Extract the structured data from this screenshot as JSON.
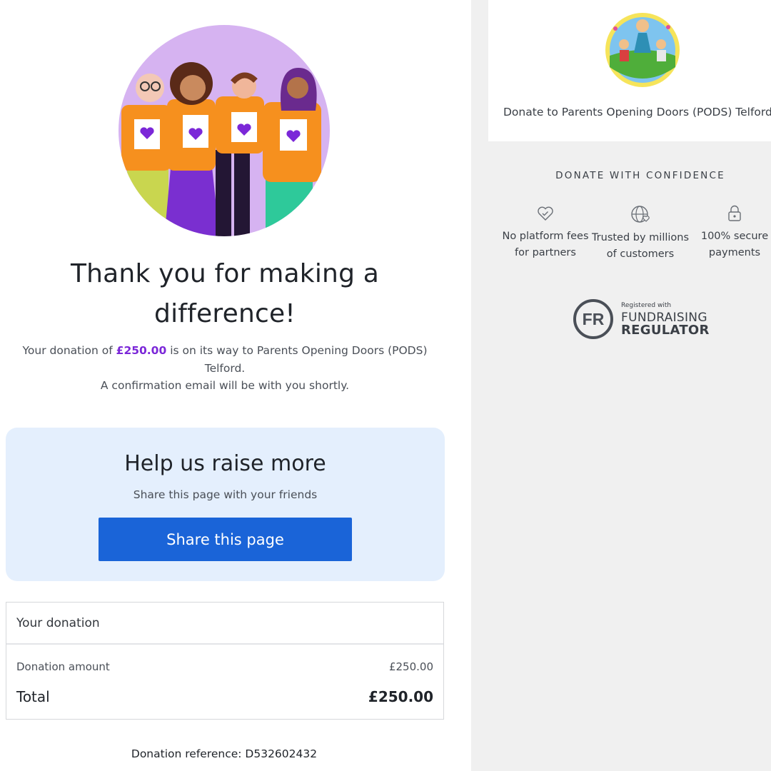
{
  "confirmation": {
    "title": "Thank you for making a difference!",
    "message_prefix": "Your donation of ",
    "amount": "£250.00",
    "message_suffix": " is on its way to Parents Opening Doors (PODS) Telford.",
    "email_note": "A confirmation email will be with you shortly."
  },
  "share": {
    "title": "Help us raise more",
    "subtitle": "Share this page with your friends",
    "button_label": "Share this page"
  },
  "donation_summary": {
    "header": "Your donation",
    "amount_label": "Donation amount",
    "amount_value": "£250.00",
    "total_label": "Total",
    "total_value": "£250.00"
  },
  "reference": "Donation reference: D532602432",
  "sidebar": {
    "charity_text": "Donate to Parents Opening Doors (PODS) Telford",
    "confidence_heading": "DONATE WITH CONFIDENCE",
    "features": [
      {
        "icon": "heart-icon",
        "text": "No platform fees for partners"
      },
      {
        "icon": "globe-heart-icon",
        "text": "Trusted by millions of customers"
      },
      {
        "icon": "lock-icon",
        "text": "100% secure payments"
      }
    ],
    "badge": {
      "initials": "FR",
      "small_text": "Registered with",
      "line1": "FUNDRAISING",
      "line2": "REGULATOR"
    }
  },
  "colors": {
    "accent_purple": "#7b27d8",
    "share_button": "#1a64d8",
    "share_card_bg": "#e4effd",
    "sidebar_bg": "#f0f0f0"
  }
}
